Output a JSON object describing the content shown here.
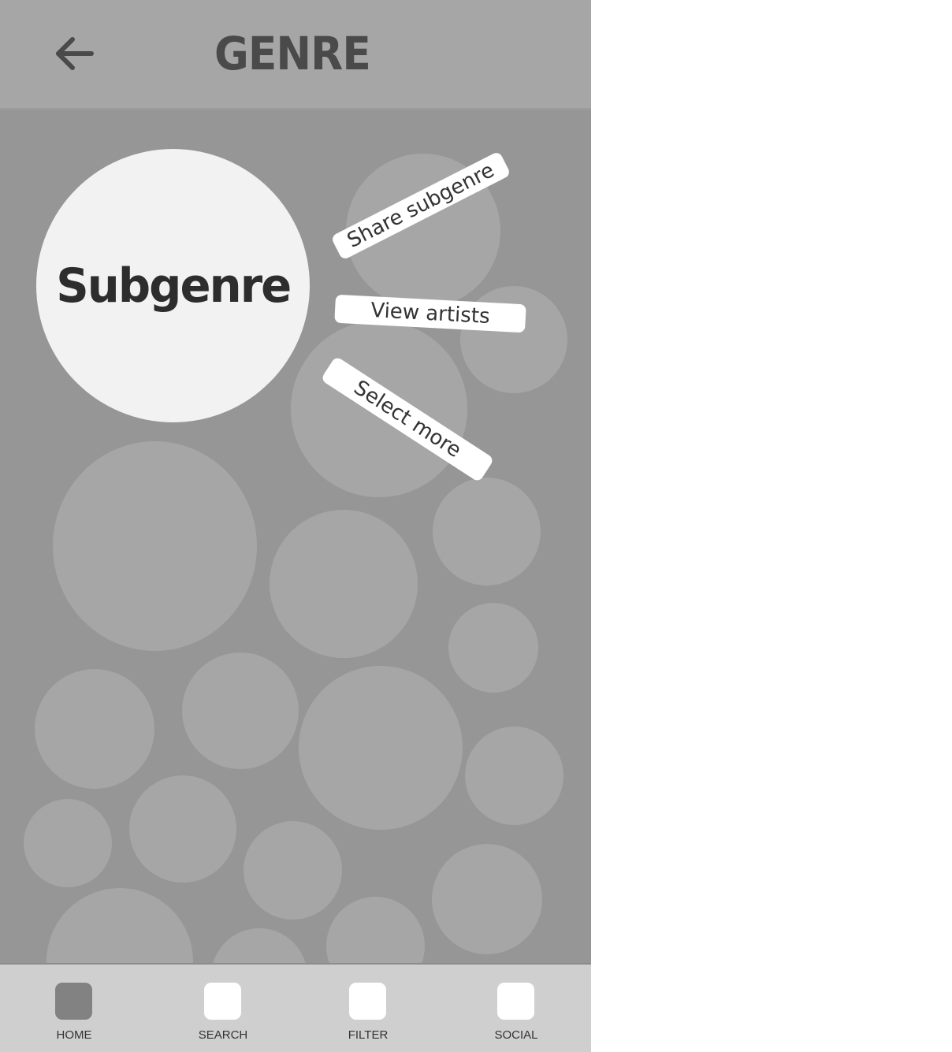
{
  "header": {
    "title": "GENRE",
    "back_icon": "arrow-left-icon"
  },
  "selected_bubble": {
    "label": "Subgenre"
  },
  "context_menu": {
    "items": [
      {
        "label": "Share subgenre"
      },
      {
        "label": "View artists"
      },
      {
        "label": "Select more"
      }
    ]
  },
  "bottom_nav": {
    "items": [
      {
        "label": "HOME",
        "icon": "home-icon",
        "active": true
      },
      {
        "label": "SEARCH",
        "icon": "search-icon",
        "active": false
      },
      {
        "label": "FILTER",
        "icon": "filter-icon",
        "active": false
      },
      {
        "label": "SOCIAL",
        "icon": "social-icon",
        "active": false
      }
    ]
  },
  "colors": {
    "canvas": "#969696",
    "header": "#a6a6a6",
    "bubble": "#a6a6a6",
    "selected_bubble": "#f2f2f2",
    "nav_bar": "#cfcfcf",
    "nav_active": "#828282",
    "nav_inactive": "#ffffff"
  }
}
